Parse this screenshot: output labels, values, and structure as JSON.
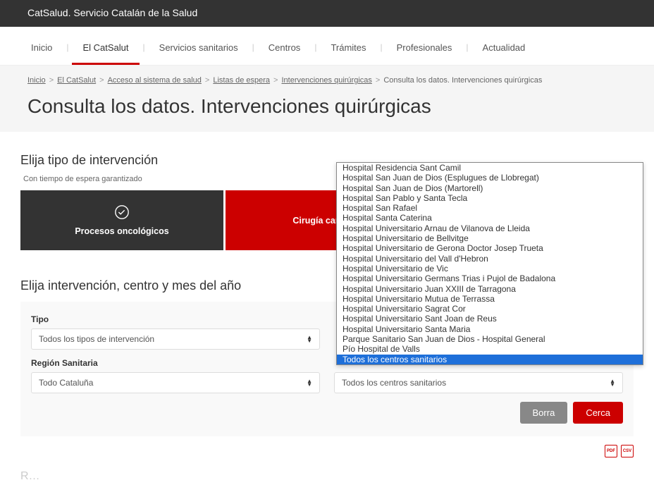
{
  "topbar": {
    "title": "CatSalud. Servicio Catalán de la Salud"
  },
  "nav": {
    "items": [
      {
        "label": "Inicio"
      },
      {
        "label": "El CatSalut"
      },
      {
        "label": "Servicios sanitarios"
      },
      {
        "label": "Centros"
      },
      {
        "label": "Trámites"
      },
      {
        "label": "Profesionales"
      },
      {
        "label": "Actualidad"
      }
    ],
    "active_index": 1
  },
  "breadcrumb": {
    "items": [
      {
        "label": "Inicio",
        "link": true
      },
      {
        "label": "El CatSalut",
        "link": true
      },
      {
        "label": "Acceso al sistema de salud",
        "link": true
      },
      {
        "label": "Listas de espera",
        "link": true
      },
      {
        "label": "Intervenciones quirúrgicas",
        "link": true
      },
      {
        "label": "Consulta los datos. Intervenciones quirúrgicas",
        "link": false
      }
    ]
  },
  "page_title": "Consulta los datos. Intervenciones quirúrgicas",
  "section1": {
    "heading": "Elija tipo de intervención",
    "subtext": "Con tiempo de espera garantizado",
    "tabs": [
      {
        "label": "Procesos oncológicos",
        "style": "dark",
        "icon": "check"
      },
      {
        "label": "Cirugía cardíaca",
        "style": "red",
        "icon": ""
      },
      {
        "label": "",
        "style": "red",
        "icon": ""
      }
    ]
  },
  "section2": {
    "heading": "Elija intervención, centro y mes del año",
    "fields": {
      "tipo": {
        "label": "Tipo",
        "value": "Todos los tipos de intervención"
      },
      "region": {
        "label": "Región Sanitaria",
        "value": "Todo Cataluña"
      },
      "centro": {
        "value": "Todos los centros sanitarios"
      }
    },
    "buttons": {
      "clear": "Borra",
      "search": "Cerca"
    }
  },
  "export": {
    "pdf": "PDF",
    "csv": "CSV"
  },
  "results_heading": "Resultados",
  "dropdown": {
    "items": [
      "Hospital Residencia Sant Camil",
      "Hospital San Juan de Dios (Esplugues de Llobregat)",
      "Hospital San Juan de Dios (Martorell)",
      "Hospital San Pablo y Santa Tecla",
      "Hospital San Rafael",
      "Hospital Santa Caterina",
      "Hospital Universitario Arnau de Vilanova de Lleida",
      "Hospital Universitario de Bellvitge",
      "Hospital Universitario de Gerona Doctor Josep Trueta",
      "Hospital Universitario del Vall d'Hebron",
      "Hospital Universitario de Vic",
      "Hospital Universitario Germans Trias i Pujol de Badalona",
      "Hospital Universitario Juan XXIII de Tarragona",
      "Hospital Universitario Mutua de Terrassa",
      "Hospital Universitario Sagrat Cor",
      "Hospital Universitario Sant Joan de Reus",
      "Hospital Universitario Santa Maria",
      "Parque Sanitario San Juan de Dios - Hospital General",
      "Pío Hospital de Valls",
      "Todos los centros sanitarios"
    ],
    "selected_index": 19
  }
}
